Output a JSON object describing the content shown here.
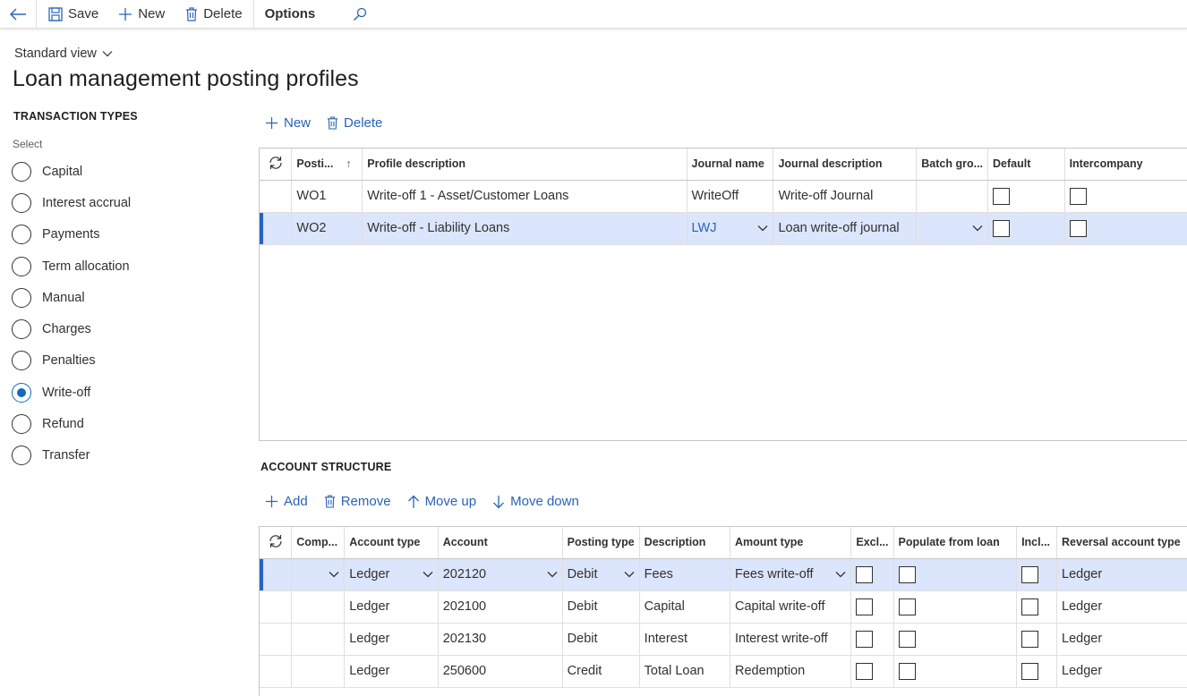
{
  "actionbar": {
    "save_label": "Save",
    "new_label": "New",
    "delete_label": "Delete",
    "options_label": "Options"
  },
  "header": {
    "view_label": "Standard view",
    "title": "Loan management posting profiles"
  },
  "transaction_types": {
    "title": "TRANSACTION TYPES",
    "select_label": "Select",
    "selected": "Write-off",
    "items": [
      "Capital",
      "Interest accrual",
      "Payments",
      "Term allocation",
      "Manual",
      "Charges",
      "Penalties",
      "Write-off",
      "Refund",
      "Transfer"
    ]
  },
  "profiles_toolbar": {
    "new_label": "New",
    "delete_label": "Delete"
  },
  "profiles_grid": {
    "columns": [
      "Posti...",
      "Profile description",
      "Journal name",
      "Journal description",
      "Batch gro...",
      "Default",
      "Intercompany"
    ],
    "rows": [
      {
        "posting": "WO1",
        "description": "Write-off 1 - Asset/Customer Loans",
        "journal_name": "WriteOff",
        "journal_description": "Write-off Journal",
        "batch_group": "",
        "default": false,
        "intercompany": false,
        "selected": false
      },
      {
        "posting": "WO2",
        "description": "Write-off - Liability Loans",
        "journal_name": "LWJ",
        "journal_description": "Loan write-off journal",
        "batch_group": "",
        "default": false,
        "intercompany": false,
        "selected": true
      }
    ]
  },
  "account_structure": {
    "title": "ACCOUNT STRUCTURE",
    "toolbar": {
      "add_label": "Add",
      "remove_label": "Remove",
      "move_up_label": "Move up",
      "move_down_label": "Move down"
    },
    "columns": [
      "Comp...",
      "Account type",
      "Account",
      "Posting type",
      "Description",
      "Amount type",
      "Excl...",
      "Populate from loan",
      "Incl...",
      "Reversal account type"
    ],
    "rows": [
      {
        "company": "",
        "account_type": "Ledger",
        "account": "202120",
        "posting_type": "Debit",
        "description": "Fees",
        "amount_type": "Fees write-off",
        "reversal_account_type": "Ledger",
        "selected": true
      },
      {
        "company": "",
        "account_type": "Ledger",
        "account": "202100",
        "posting_type": "Debit",
        "description": "Capital",
        "amount_type": "Capital write-off",
        "reversal_account_type": "Ledger",
        "selected": false
      },
      {
        "company": "",
        "account_type": "Ledger",
        "account": "202130",
        "posting_type": "Debit",
        "description": "Interest",
        "amount_type": "Interest write-off",
        "reversal_account_type": "Ledger",
        "selected": false
      },
      {
        "company": "",
        "account_type": "Ledger",
        "account": "250600",
        "posting_type": "Credit",
        "description": "Total Loan",
        "amount_type": "Redemption",
        "reversal_account_type": "Ledger",
        "selected": false
      }
    ]
  },
  "colors": {
    "accent": "#2b63b6",
    "selected_row": "#dbe5fb",
    "selected_marker": "#2962c4"
  }
}
